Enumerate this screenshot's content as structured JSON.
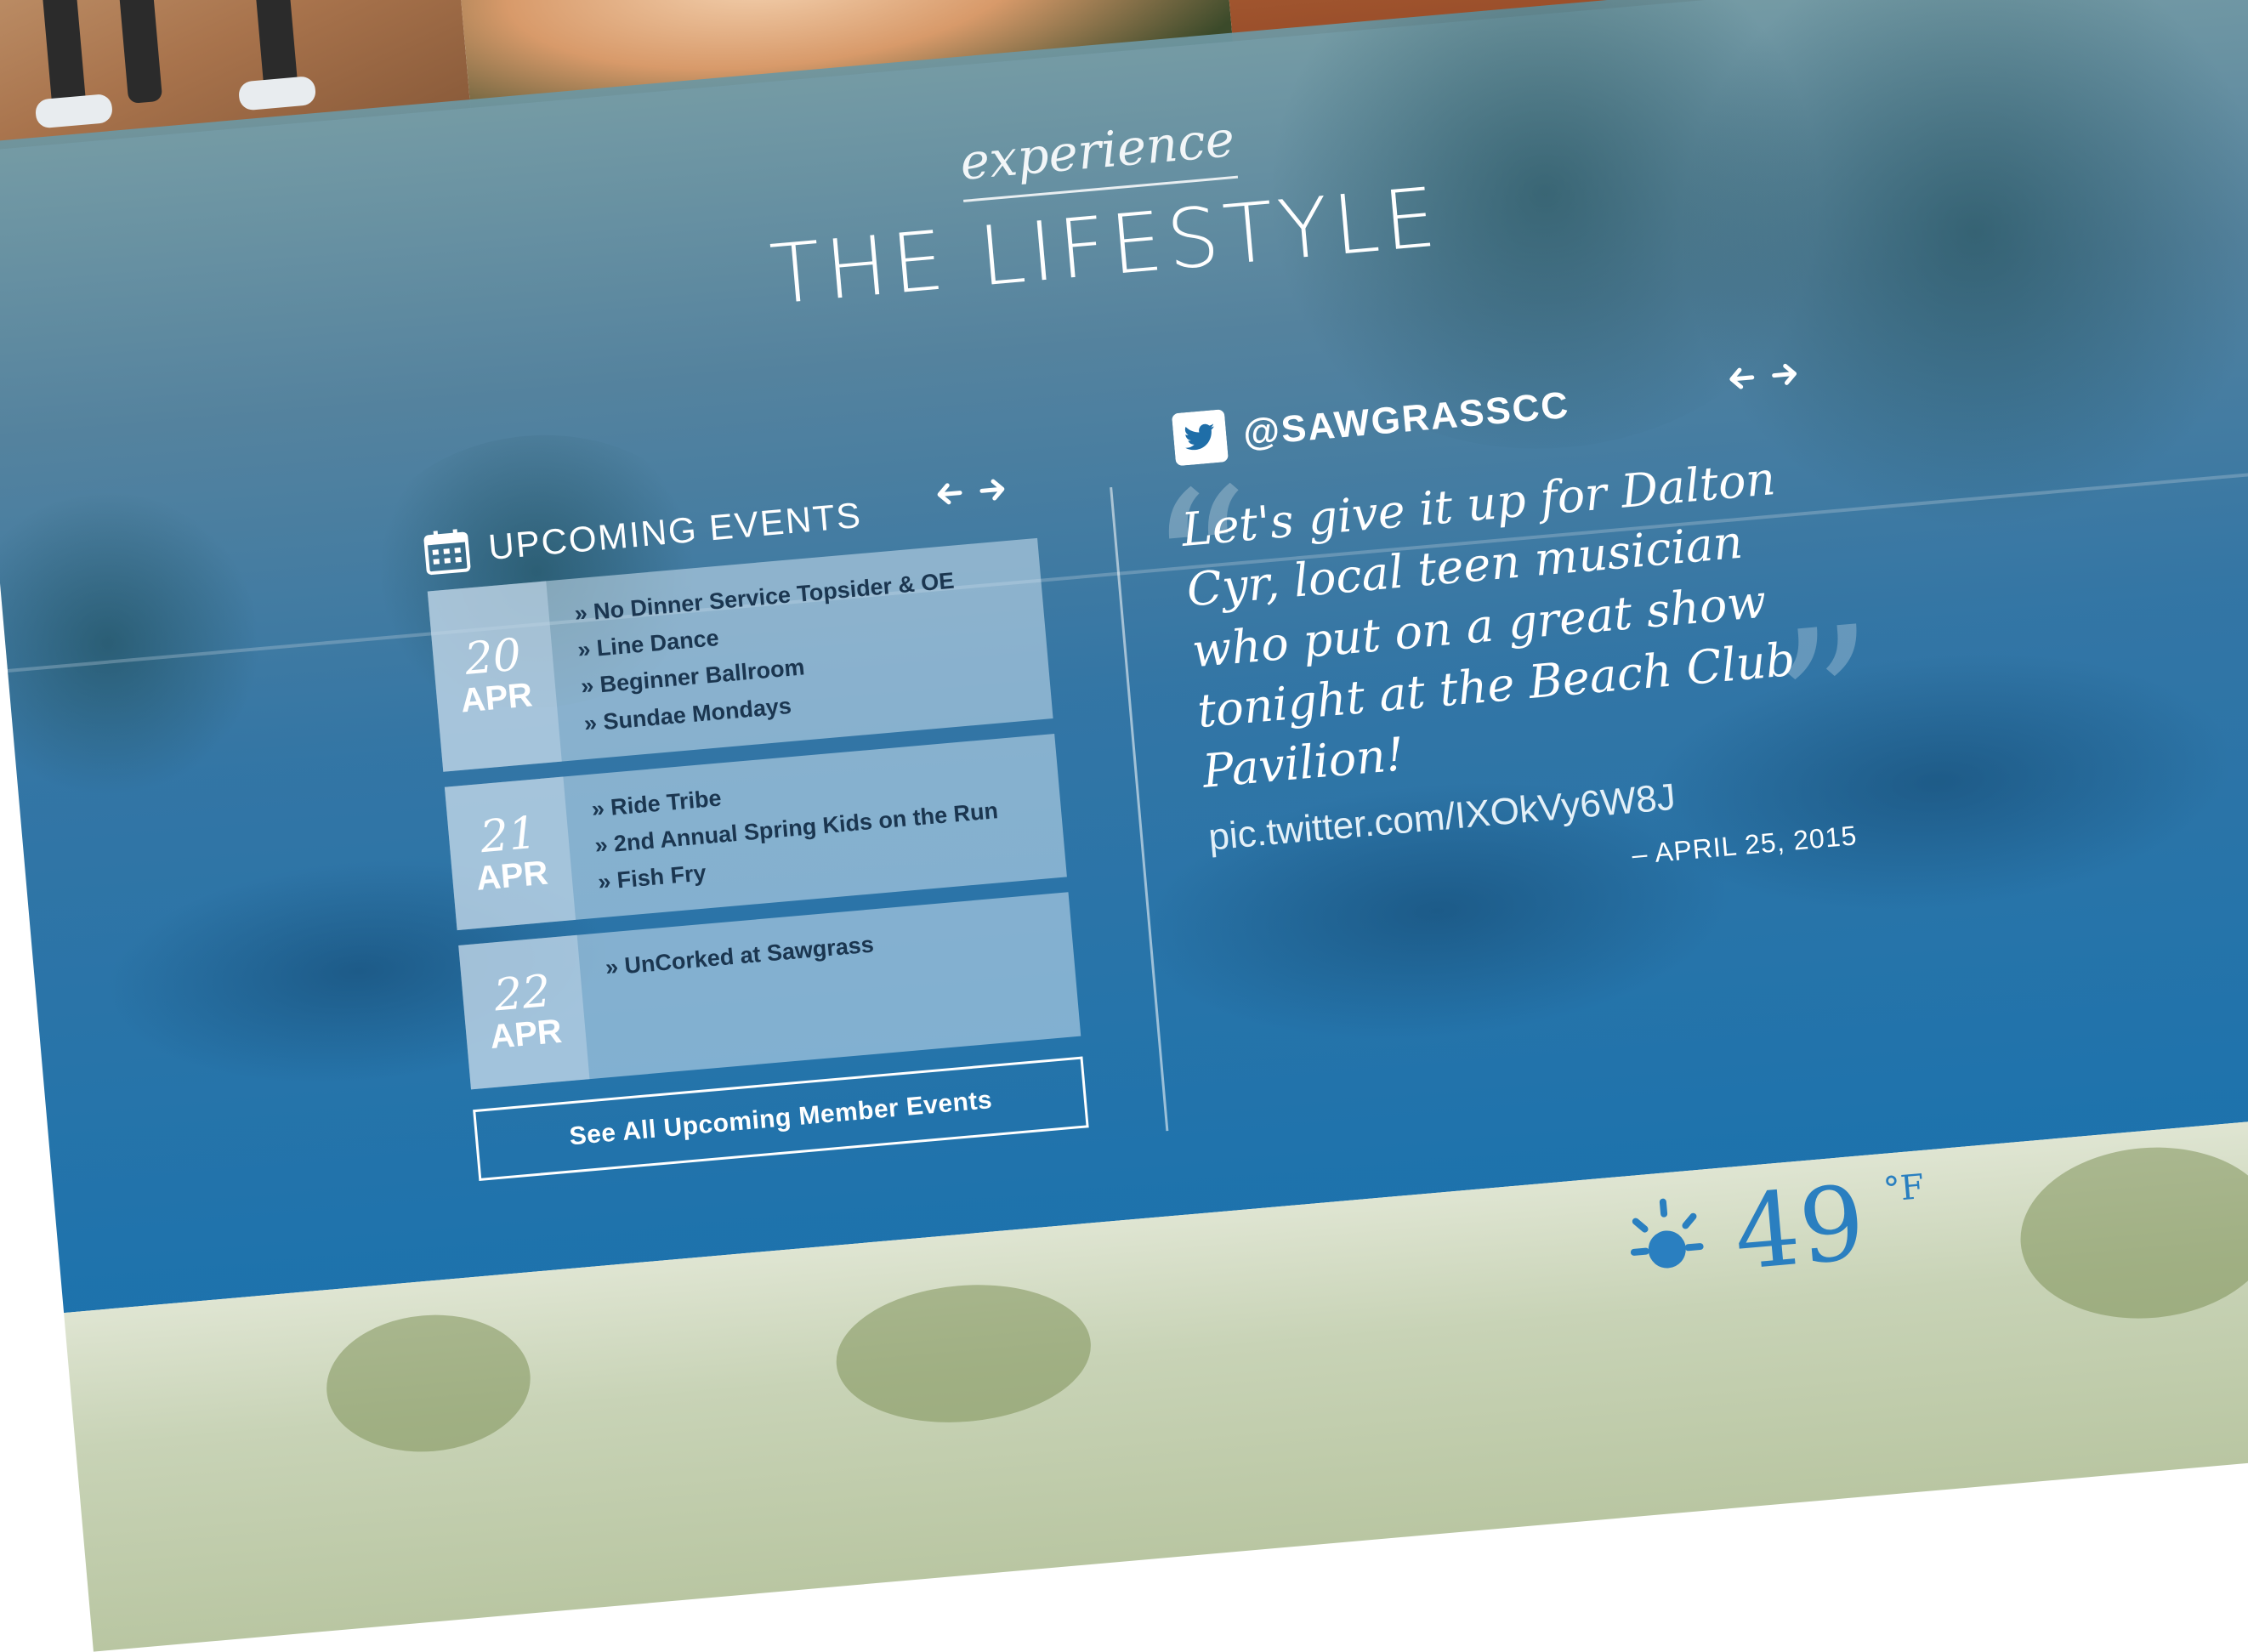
{
  "heading": {
    "kicker": "experience",
    "title": "THE LIFESTYLE"
  },
  "events": {
    "title": "UPCOMING EVENTS",
    "icon": "calendar-icon",
    "days": [
      {
        "day": "20",
        "month": "APR",
        "items": [
          "No Dinner Service Topsider & OE",
          "Line Dance",
          "Beginner Ballroom",
          "Sundae Mondays"
        ]
      },
      {
        "day": "21",
        "month": "APR",
        "items": [
          "Ride Tribe",
          "2nd Annual Spring Kids on the Run",
          "Fish Fry"
        ]
      },
      {
        "day": "22",
        "month": "APR",
        "items": [
          "UnCorked at Sawgrass"
        ]
      }
    ],
    "see_all_label": "See All Upcoming Member Events"
  },
  "tweet": {
    "icon": "twitter-icon",
    "handle": "@SAWGRASSCC",
    "text": "Let's give it up for Dalton Cyr, local teen musician who put on a great show tonight at the Beach Club Pavilion!",
    "link": "pic.twitter.com/IXOkVy6W8J",
    "date": "– APRIL 25, 2015"
  },
  "weather": {
    "icon": "sun-icon",
    "temp": "49",
    "unit": "°F"
  },
  "colors": {
    "panel_blue": "#1f6ea8",
    "text_white": "#ffffff",
    "event_text": "#1b3650",
    "accent_blue": "#2a7fc0"
  }
}
